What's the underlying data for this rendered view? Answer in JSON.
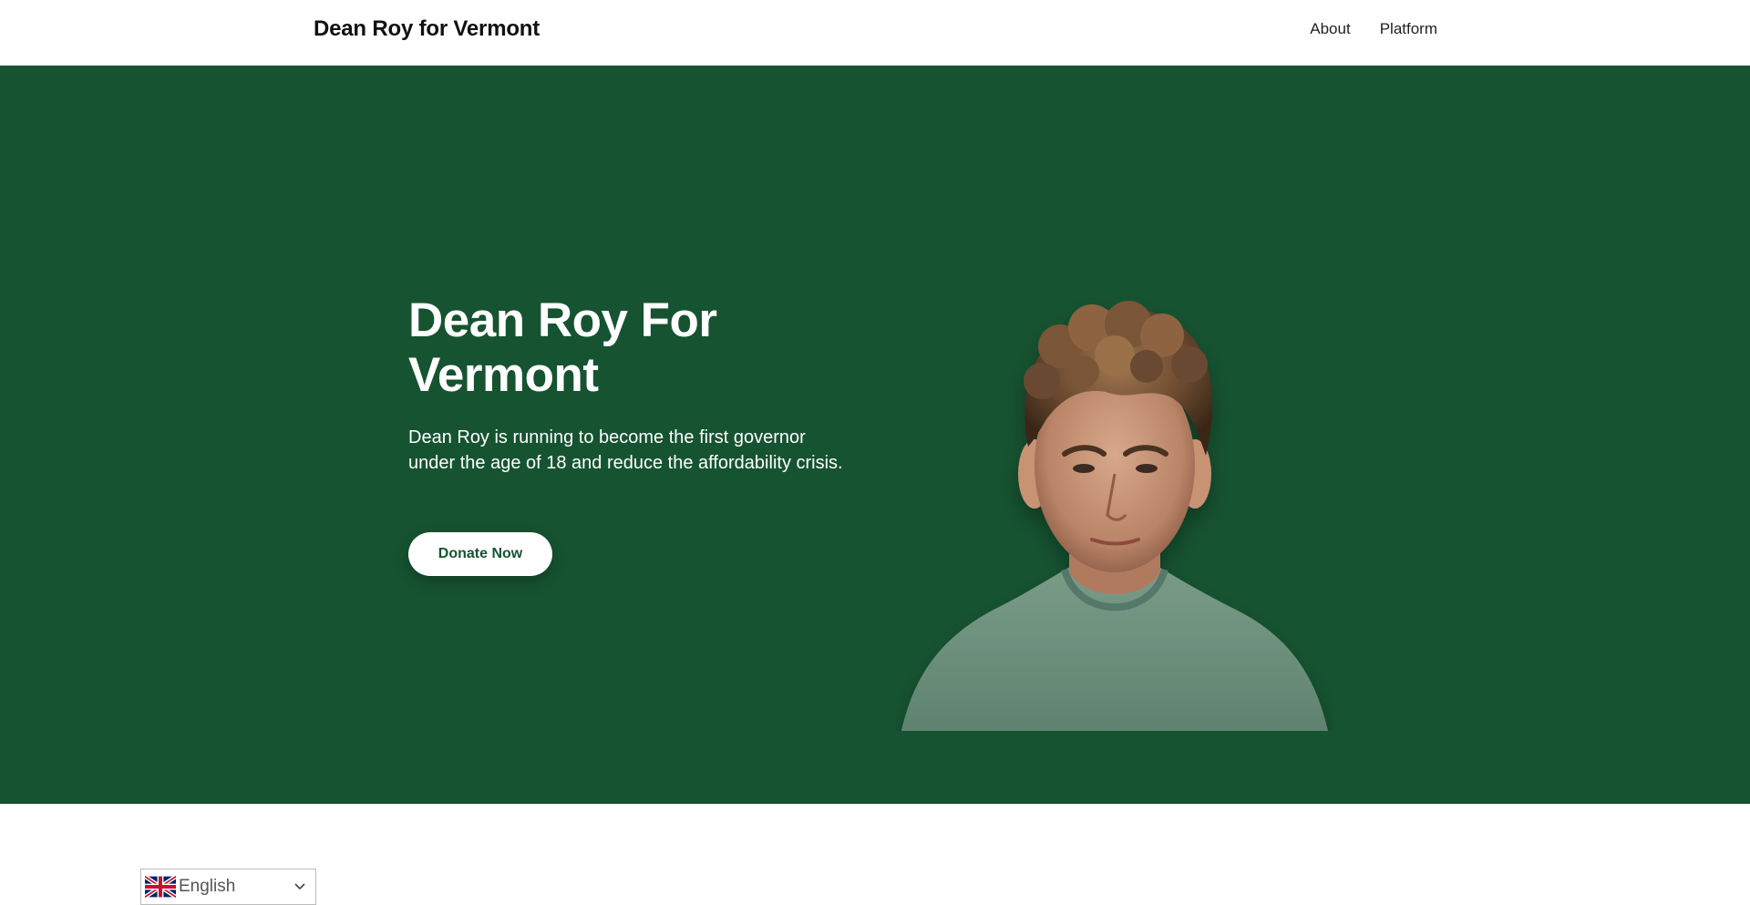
{
  "nav": {
    "brand": "Dean Roy for Vermont",
    "links": [
      "About",
      "Platform"
    ]
  },
  "hero": {
    "title": "Dean Roy For Vermont",
    "description": "Dean Roy is running to become the first governor under the age of 18 and reduce the affordability crisis.",
    "button_label": "Donate Now",
    "background_color": "#165331"
  },
  "language_selector": {
    "selected": "English",
    "flag_icon": "uk-flag-icon"
  }
}
